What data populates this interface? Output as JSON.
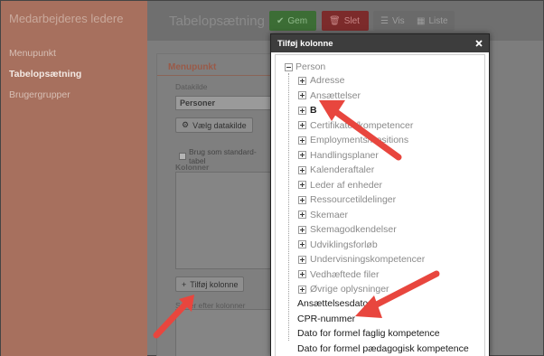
{
  "sidebar": {
    "title": "Medarbejderes ledere",
    "items": [
      {
        "label": "Menupunkt",
        "active": false
      },
      {
        "label": "Tabelopsætning",
        "active": true
      },
      {
        "label": "Brugergrupper",
        "active": false
      }
    ]
  },
  "main": {
    "title": "Tabelopsætning",
    "toolbar": {
      "save_label": "Gem",
      "delete_label": "Slet",
      "view_label": "Vis",
      "list_label": "Liste"
    },
    "panel": {
      "header": "Menupunkt",
      "datasource_label": "Datakilde",
      "datasource_value": "Personer",
      "choose_datasource_label": "Vælg datakilde",
      "standard_table_label": "Brug som standard-tabel",
      "columns_label": "Kolonner",
      "add_column_label": "Tilføj kolonne",
      "sort_label": "Sortér efter kolonner"
    }
  },
  "modal": {
    "title": "Tilføj kolonne",
    "root": "Person",
    "groups": [
      "Adresse",
      "Ansættelser",
      "B",
      "Certifikater/kompetencer",
      "Employments/Positions",
      "Handlingsplaner",
      "Kalenderaftaler",
      "Leder af enheder",
      "Ressourcetildelinger",
      "Skemaer",
      "Skemagodkendelser",
      "Udviklingsforløb",
      "Undervisningskompetencer",
      "Vedhæftede filer",
      "Øvrige oplysninger"
    ],
    "fields": [
      "Ansættelsesdato",
      "CPR-nummer",
      "Dato for formel faglig kompetence",
      "Dato for formel pædagogisk kompetence"
    ]
  },
  "colors": {
    "accent_arrow": "#e8463e",
    "sidebar_bg": "#a7705e",
    "modal_header": "#3d3d3d"
  }
}
